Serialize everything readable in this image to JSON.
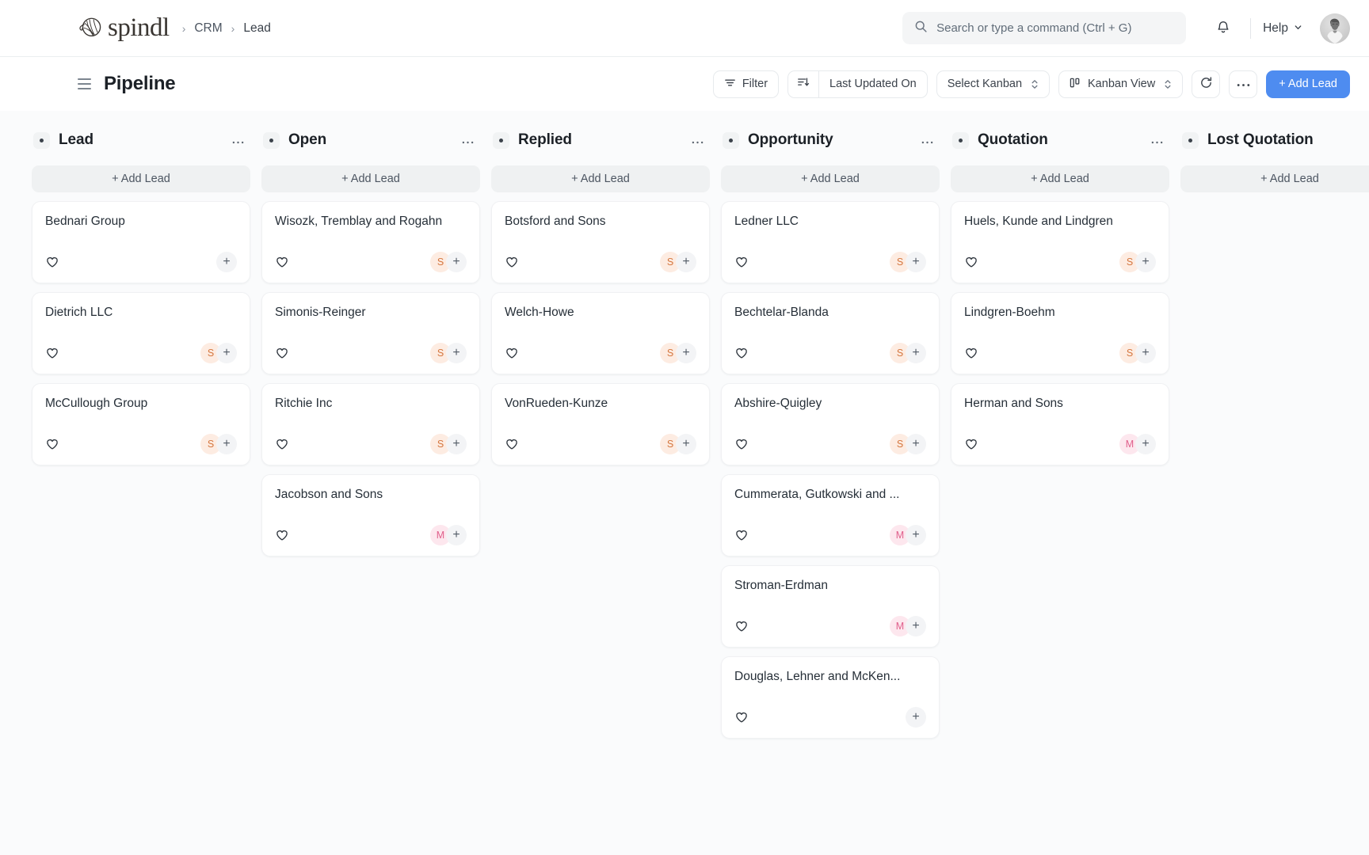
{
  "navbar": {
    "brand_name": "spindl",
    "brand_icon": "yarn-ball-icon",
    "breadcrumb": [
      {
        "label": "CRM"
      },
      {
        "label": "Lead"
      }
    ],
    "search": {
      "placeholder": "Search or type a command (Ctrl + G)",
      "value": "",
      "icon": "search-icon"
    },
    "notification_icon": "bell-icon",
    "help_label": "Help",
    "avatar_alt": "user-avatar"
  },
  "page_header": {
    "menu_icon": "hamburger-icon",
    "title": "Pipeline",
    "toolbar": {
      "filter_label": "Filter",
      "filter_icon": "filter-icon",
      "sort_icon": "sort-descending-icon",
      "sort_label": "Last Updated On",
      "select_kanban_label": "Select Kanban",
      "kanban_view_label": "Kanban View",
      "kanban_view_icon": "kanban-icon",
      "refresh_icon": "refresh-icon",
      "more_icon": "ellipsis-icon",
      "add_lead_label": "+ Add Lead"
    }
  },
  "board": {
    "add_lead_label": "+ Add Lead",
    "more_icon": "ellipsis-icon",
    "heart_icon": "heart-icon",
    "plus_icon": "plus-icon",
    "colors": {
      "accent": "#4e8cf0",
      "avatar_s_bg": "#fdece2",
      "avatar_s_fg": "#d4763e",
      "avatar_m_bg": "#fde7ee",
      "avatar_m_fg": "#e0608c",
      "board_bg": "#fafbfc"
    },
    "columns": [
      {
        "title": "Lead",
        "cards": [
          {
            "title": "Bednari Group",
            "assignees": []
          },
          {
            "title": "Dietrich LLC",
            "assignees": [
              {
                "initial": "S",
                "kind": "s"
              }
            ]
          },
          {
            "title": "McCullough Group",
            "assignees": [
              {
                "initial": "S",
                "kind": "s"
              }
            ]
          }
        ]
      },
      {
        "title": "Open",
        "cards": [
          {
            "title": "Wisozk, Tremblay and Rogahn",
            "assignees": [
              {
                "initial": "S",
                "kind": "s"
              }
            ]
          },
          {
            "title": "Simonis-Reinger",
            "assignees": [
              {
                "initial": "S",
                "kind": "s"
              }
            ]
          },
          {
            "title": "Ritchie Inc",
            "assignees": [
              {
                "initial": "S",
                "kind": "s"
              }
            ]
          },
          {
            "title": "Jacobson and Sons",
            "assignees": [
              {
                "initial": "M",
                "kind": "m"
              }
            ]
          }
        ]
      },
      {
        "title": "Replied",
        "cards": [
          {
            "title": "Botsford and Sons",
            "assignees": [
              {
                "initial": "S",
                "kind": "s"
              }
            ]
          },
          {
            "title": "Welch-Howe",
            "assignees": [
              {
                "initial": "S",
                "kind": "s"
              }
            ]
          },
          {
            "title": "VonRueden-Kunze",
            "assignees": [
              {
                "initial": "S",
                "kind": "s"
              }
            ]
          }
        ]
      },
      {
        "title": "Opportunity",
        "cards": [
          {
            "title": "Ledner LLC",
            "assignees": [
              {
                "initial": "S",
                "kind": "s"
              }
            ]
          },
          {
            "title": "Bechtelar-Blanda",
            "assignees": [
              {
                "initial": "S",
                "kind": "s"
              }
            ]
          },
          {
            "title": "Abshire-Quigley",
            "assignees": [
              {
                "initial": "S",
                "kind": "s"
              }
            ]
          },
          {
            "title": "Cummerata, Gutkowski and ...",
            "assignees": [
              {
                "initial": "M",
                "kind": "m"
              }
            ]
          },
          {
            "title": "Stroman-Erdman",
            "assignees": [
              {
                "initial": "M",
                "kind": "m"
              }
            ]
          },
          {
            "title": "Douglas, Lehner and McKen...",
            "assignees": []
          }
        ]
      },
      {
        "title": "Quotation",
        "cards": [
          {
            "title": "Huels, Kunde and Lindgren",
            "assignees": [
              {
                "initial": "S",
                "kind": "s"
              }
            ]
          },
          {
            "title": "Lindgren-Boehm",
            "assignees": [
              {
                "initial": "S",
                "kind": "s"
              }
            ]
          },
          {
            "title": "Herman and Sons",
            "assignees": [
              {
                "initial": "M",
                "kind": "m"
              }
            ]
          }
        ]
      },
      {
        "title": "Lost Quotation",
        "cards": []
      }
    ]
  }
}
